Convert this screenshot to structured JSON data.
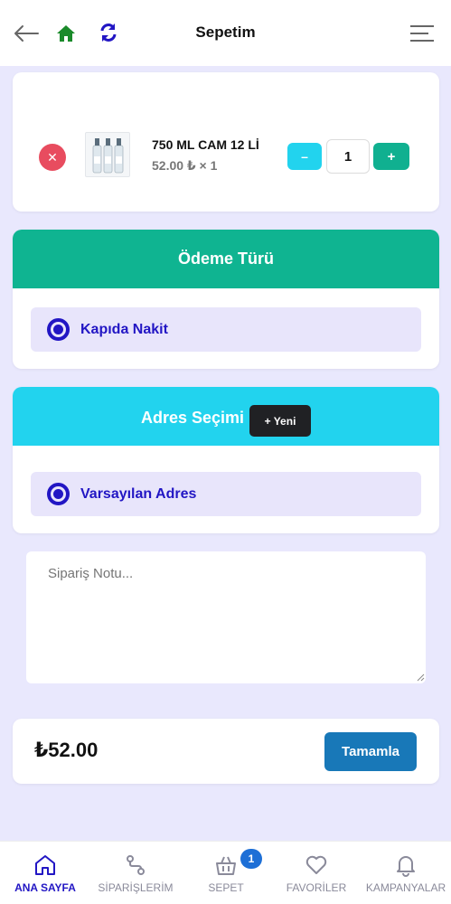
{
  "header": {
    "title": "Sepetim",
    "back_icon": "arrow-left-icon",
    "home_icon": "home-icon",
    "refresh_icon": "refresh-icon",
    "menu_icon": "menu-icon"
  },
  "cart": {
    "items": [
      {
        "name": "750 ML CAM 12 Lİ",
        "price_line": "52.00 ₺ × 1",
        "quantity": "1",
        "minus_label": "–",
        "plus_label": "+"
      }
    ]
  },
  "payment": {
    "title": "Ödeme Türü",
    "options": [
      {
        "label": "Kapıda Nakit",
        "selected": true
      }
    ]
  },
  "address": {
    "title": "Adres Seçimi",
    "new_button": "+ Yeni",
    "options": [
      {
        "label": "Varsayılan Adres",
        "selected": true
      }
    ]
  },
  "note": {
    "placeholder": "Sipariş Notu..."
  },
  "summary": {
    "total": "₺52.00",
    "complete_button": "Tamamla"
  },
  "bottom_nav": {
    "items": [
      {
        "label": "ANA SAYFA",
        "icon": "home-outline-icon",
        "active": true
      },
      {
        "label": "SİPARİŞLERİM",
        "icon": "route-icon",
        "active": false
      },
      {
        "label": "SEPET",
        "icon": "basket-icon",
        "active": false
      },
      {
        "label": "FAVORİLER",
        "icon": "heart-icon",
        "active": false
      },
      {
        "label": "KAMPANYALAR",
        "icon": "bell-icon",
        "active": false
      }
    ],
    "cart_badge": "1"
  },
  "colors": {
    "background": "#e9e8fd",
    "payment_header": "#0fb491",
    "address_header": "#22d3ee",
    "accent": "#2216c4",
    "complete_button": "#1878b8",
    "remove_button": "#e84c5f"
  }
}
